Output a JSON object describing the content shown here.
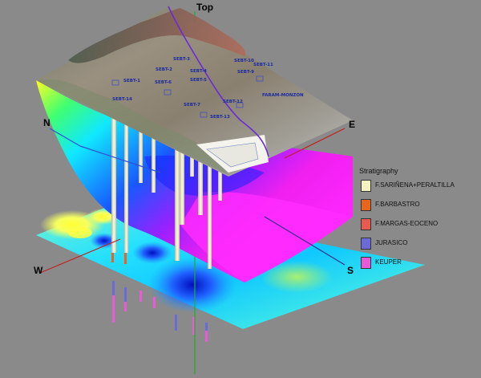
{
  "directions": {
    "top": "Top",
    "north": "N",
    "east": "E",
    "west": "W",
    "south": "S"
  },
  "legend": {
    "title": "Stratigraphy",
    "items": [
      {
        "label": "F.SARIÑENA+PERALTILLA",
        "color": "#f4f2c0"
      },
      {
        "label": "F.BARBASTRO",
        "color": "#e8661c"
      },
      {
        "label": "F.MARGAS-EOCENO",
        "color": "#e85a50"
      },
      {
        "label": "JURASICO",
        "color": "#6a6ad8"
      },
      {
        "label": "KEUPER",
        "color": "#e85ad8"
      }
    ]
  },
  "wells": [
    "SEBT-2",
    "SEBT-10",
    "SEBT-3",
    "SEBT-4",
    "SEBT-1",
    "SEBT-6",
    "SEBT-5",
    "SEBT-9",
    "SEBT-11",
    "SEBT-14",
    "SEBT-7",
    "SEBT-12",
    "SEBT-13"
  ],
  "fault_label": "FARAM-MONZON"
}
